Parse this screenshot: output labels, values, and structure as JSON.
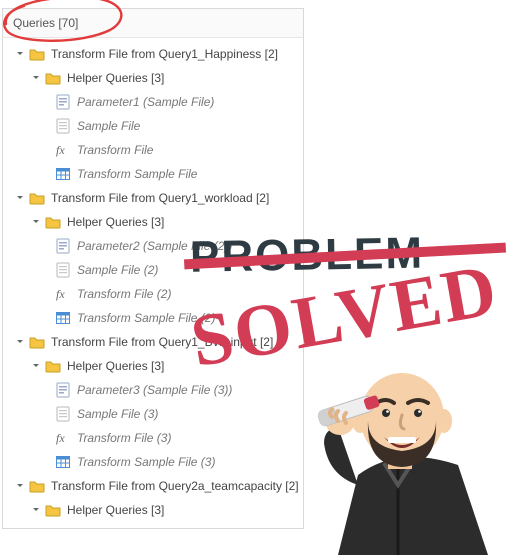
{
  "header": {
    "title": "Queries [70]"
  },
  "overlay": {
    "problem": "PROBLEM",
    "solved": "SOLVED"
  },
  "groups": [
    {
      "label": "Transform File from Query1_Happiness [2]",
      "helper_label": "Helper Queries [3]",
      "items": [
        {
          "kind": "param",
          "label": "Parameter1 (Sample File)"
        },
        {
          "kind": "file",
          "label": "Sample File"
        },
        {
          "kind": "fx",
          "label": "Transform File"
        },
        {
          "kind": "table",
          "label": "Transform Sample File"
        }
      ]
    },
    {
      "label": "Transform File from Query1_workload [2]",
      "helper_label": "Helper Queries [3]",
      "items": [
        {
          "kind": "param",
          "label": "Parameter2 (Sample File (2))"
        },
        {
          "kind": "file",
          "label": "Sample File (2)"
        },
        {
          "kind": "fx",
          "label": "Transform File (2)"
        },
        {
          "kind": "table",
          "label": "Transform Sample File (2)"
        }
      ]
    },
    {
      "label": "Transform File from Query1_BW_input [2]",
      "helper_label": "Helper Queries [3]",
      "items": [
        {
          "kind": "param",
          "label": "Parameter3 (Sample File (3))"
        },
        {
          "kind": "file",
          "label": "Sample File (3)"
        },
        {
          "kind": "fx",
          "label": "Transform File (3)"
        },
        {
          "kind": "table",
          "label": "Transform Sample File (3)"
        }
      ]
    },
    {
      "label": "Transform File from Query2a_teamcapacity [2]",
      "helper_label": "Helper Queries [3]",
      "items": []
    }
  ]
}
